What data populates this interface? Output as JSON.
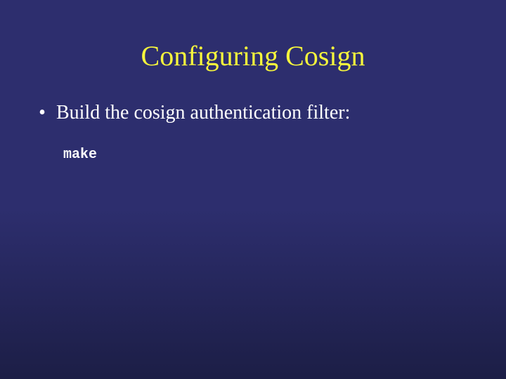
{
  "title": "Configuring Cosign",
  "bullet": {
    "text": "Build the cosign authentication filter:"
  },
  "code": "make"
}
